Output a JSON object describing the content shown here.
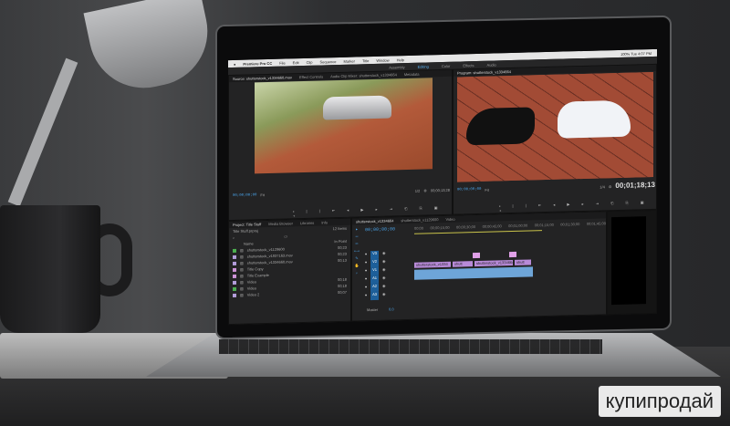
{
  "menubar": {
    "app": "Premiere Pro CC",
    "items": [
      "File",
      "Edit",
      "Clip",
      "Sequence",
      "Marker",
      "Title",
      "Window",
      "Help"
    ],
    "status": "100%  Tue 4:07 PM"
  },
  "workspaces": {
    "items": [
      "Assembly",
      "Editing",
      "Color",
      "Effects",
      "Audio"
    ],
    "active": "Editing"
  },
  "source": {
    "tabs": [
      "Source: shutterstock_v1334660.mov",
      "Effect Controls",
      "Audio Clip Mixer: shutterstock_v1334664",
      "Metadata"
    ],
    "timecode": "00;00;00;00",
    "fit": "Fit",
    "scale": "1/2",
    "duration": "00;00;13;28"
  },
  "program": {
    "tab": "Program: shutterstock_v1334664",
    "timecode": "00;00;00;00",
    "fit": "Fit",
    "scale": "1/4",
    "duration": "00;01;18;13"
  },
  "project": {
    "tabs": [
      "Project: Title Stuff",
      "Media Browser",
      "Libraries",
      "Info"
    ],
    "file": "Title Stuff.prproj",
    "count": "12 Items",
    "col_name": "Name",
    "col_end": "In Point",
    "items": [
      {
        "name": "shutterstock_v1129600",
        "time": "00;23",
        "color": "#4caf50"
      },
      {
        "name": "shutterstock_v1937163.mov",
        "time": "00;23",
        "color": "#b39ddb"
      },
      {
        "name": "shutterstock_v1334660.mov",
        "time": "00;13",
        "color": "#b39ddb"
      },
      {
        "name": "Title Copy",
        "time": "",
        "color": "#ce93d8"
      },
      {
        "name": "Title Example",
        "time": "",
        "color": "#ce93d8"
      },
      {
        "name": "Video",
        "time": "00;18",
        "color": "#b39ddb"
      },
      {
        "name": "Video",
        "time": "00;18",
        "color": "#4caf50"
      },
      {
        "name": "Video 2",
        "time": "00;07",
        "color": "#b39ddb"
      }
    ]
  },
  "timeline": {
    "tabs": [
      "shutterstock_v1334664",
      "shutterstock_v1129600",
      "Video"
    ],
    "timecode": "00;00;00;00",
    "ruler": [
      "00;00",
      "00;00;15;00",
      "00;00;30;00",
      "00;00;45;00",
      "00;01;00;00",
      "00;01;15;00",
      "00;01;30;00",
      "00;01;45;00"
    ],
    "tracks": [
      "V3",
      "V2",
      "V1",
      "A1",
      "A2",
      "A3"
    ],
    "master": "Master",
    "master_val": "0.0",
    "clips": [
      "shutterstock_v1334",
      "shutt",
      "shutterstock_v1334664",
      "shutt"
    ]
  },
  "watermark": "купипродай"
}
